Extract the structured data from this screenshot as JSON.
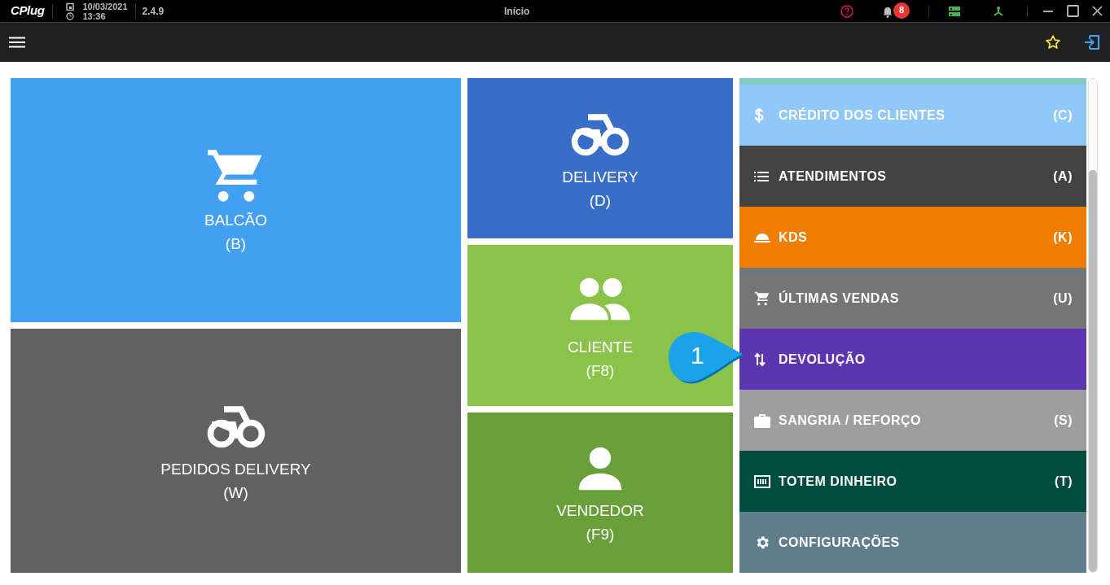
{
  "title_bar": {
    "logo": "CPlug",
    "date": "10/03/2021",
    "time": "13:36",
    "version": "2.4.9",
    "title": "Início",
    "notification_count": "8"
  },
  "tiles": [
    {
      "label": "BALCÃO",
      "shortcut": "(B)",
      "color": "#42a0f2"
    },
    {
      "label": "PEDIDOS DELIVERY",
      "shortcut": "(W)",
      "color": "#616161"
    },
    {
      "label": "DELIVERY",
      "shortcut": "(D)",
      "color": "#386dc8"
    },
    {
      "label": "CLIENTE",
      "shortcut": "(F8)",
      "color": "#8bc34a"
    },
    {
      "label": "VENDEDOR",
      "shortcut": "(F9)",
      "color": "#689f38"
    }
  ],
  "menu": [
    {
      "label": "CRÉDITO DOS CLIENTES",
      "shortcut": "(C)",
      "color": "#90c8f8"
    },
    {
      "label": "ATENDIMENTOS",
      "shortcut": "(A)",
      "color": "#424242"
    },
    {
      "label": "KDS",
      "shortcut": "(K)",
      "color": "#ef7d00"
    },
    {
      "label": "ÚLTIMAS VENDAS",
      "shortcut": "(U)",
      "color": "#757575"
    },
    {
      "label": "DEVOLUÇÃO",
      "color": "#5e35b1"
    },
    {
      "label": "SANGRIA / REFORÇO",
      "shortcut": "(S)",
      "color": "#9e9e9e"
    },
    {
      "label": "TOTEM DINHEIRO",
      "shortcut": "(T)",
      "color": "#004d40"
    },
    {
      "label": "CONFIGURAÇÕES",
      "color": "#607d8b"
    }
  ],
  "callout": {
    "number": "1"
  }
}
